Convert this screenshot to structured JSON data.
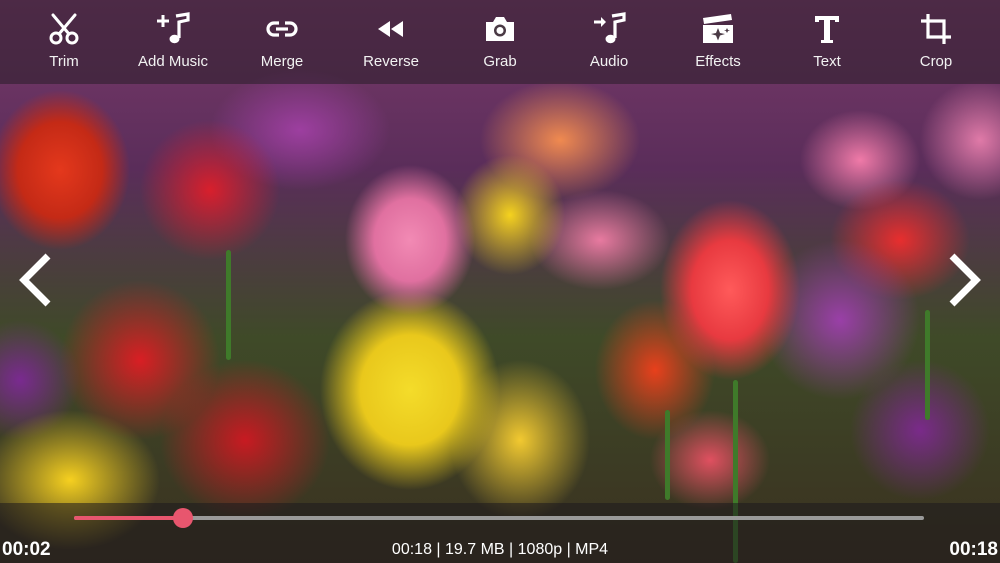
{
  "toolbar": {
    "items": [
      {
        "label": "Trim",
        "icon": "scissors-icon"
      },
      {
        "label": "Add Music",
        "icon": "add-music-icon"
      },
      {
        "label": "Merge",
        "icon": "link-icon"
      },
      {
        "label": "Reverse",
        "icon": "rewind-icon"
      },
      {
        "label": "Grab",
        "icon": "camera-icon"
      },
      {
        "label": "Audio",
        "icon": "audio-icon"
      },
      {
        "label": "Effects",
        "icon": "clapperboard-sparkle-icon"
      },
      {
        "label": "Text",
        "icon": "text-icon"
      },
      {
        "label": "Crop",
        "icon": "crop-icon"
      }
    ]
  },
  "navigation": {
    "prev_icon": "chevron-left-icon",
    "next_icon": "chevron-right-icon"
  },
  "playback": {
    "current_time": "00:02",
    "total_time": "00:18",
    "progress_fraction": 0.128,
    "info": "00:18 | 19.7 MB | 1080p | MP4"
  },
  "colors": {
    "accent": "#e8566e",
    "track": "#9a9a9a"
  }
}
